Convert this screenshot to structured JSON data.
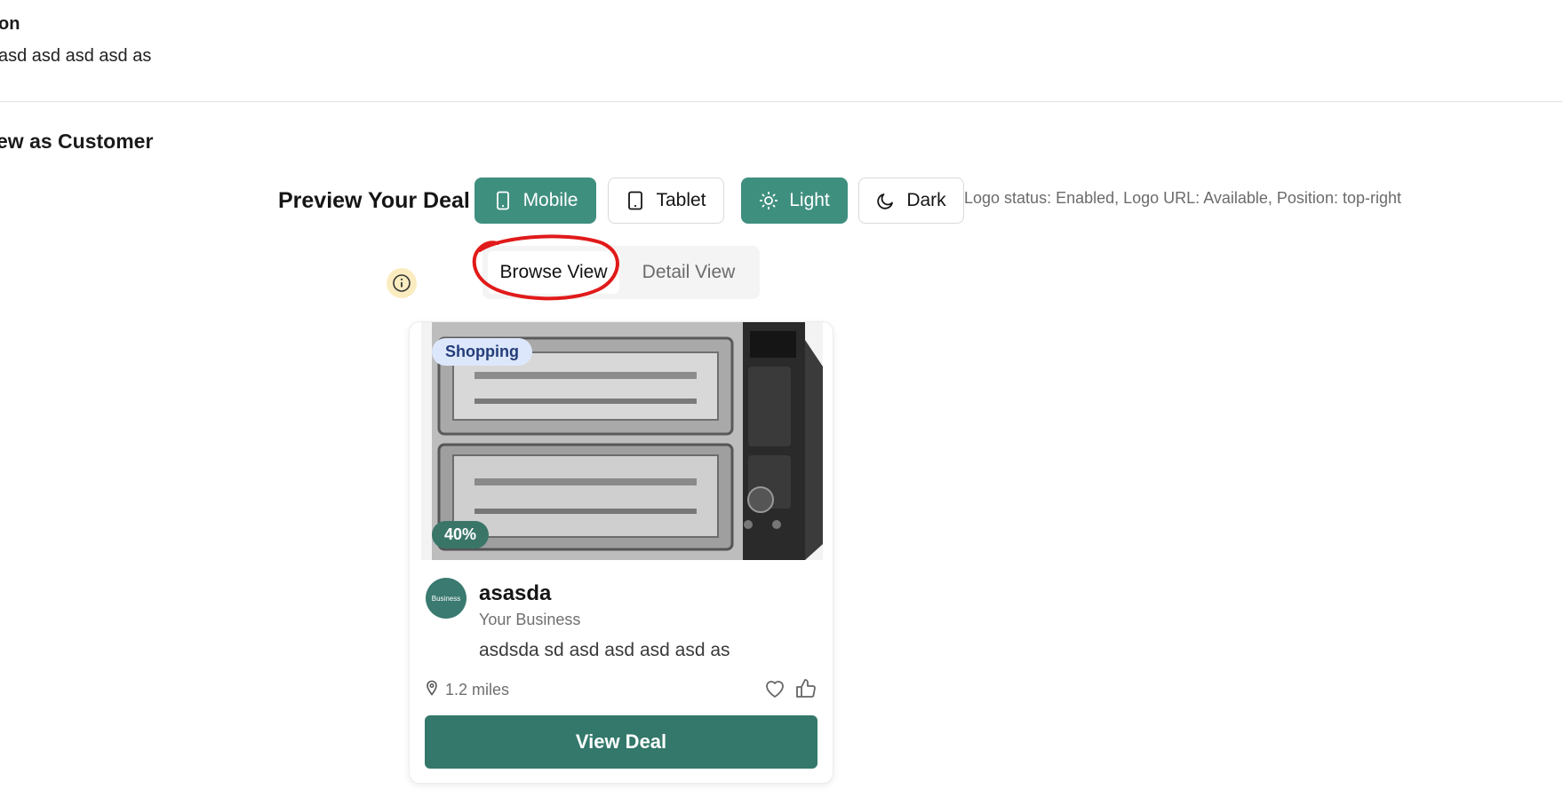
{
  "header": {
    "section_title_fragment": "on",
    "description_fragment": "asd asd asd asd as"
  },
  "section": {
    "title": "ew as Customer"
  },
  "preview": {
    "title": "Preview Your Deal",
    "device_buttons": [
      {
        "label": "Mobile",
        "icon": "phone-icon",
        "active": true
      },
      {
        "label": "Tablet",
        "icon": "tablet-icon",
        "active": false
      }
    ],
    "theme_buttons": [
      {
        "label": "Light",
        "icon": "sun-icon",
        "active": true
      },
      {
        "label": "Dark",
        "icon": "moon-icon",
        "active": false
      }
    ],
    "logo_status": "Logo status: Enabled, Logo URL: Available, Position: top-right",
    "view_tabs": [
      {
        "label": "Browse View",
        "active": true
      },
      {
        "label": "Detail View",
        "active": false
      }
    ]
  },
  "card": {
    "category": "Shopping",
    "discount": "40%",
    "avatar_text": "Business",
    "title": "asasda",
    "business": "Your Business",
    "description": "asdsda sd asd asd asd asd as",
    "distance": "1.2 miles",
    "cta": "View Deal"
  },
  "colors": {
    "primary": "#3f8f7f",
    "primary_dark": "#33786a",
    "badge_blue_bg": "#dde7fb",
    "badge_blue_text": "#243d7a",
    "info_bg": "#fbecc0",
    "annotation": "#e11a1a"
  }
}
